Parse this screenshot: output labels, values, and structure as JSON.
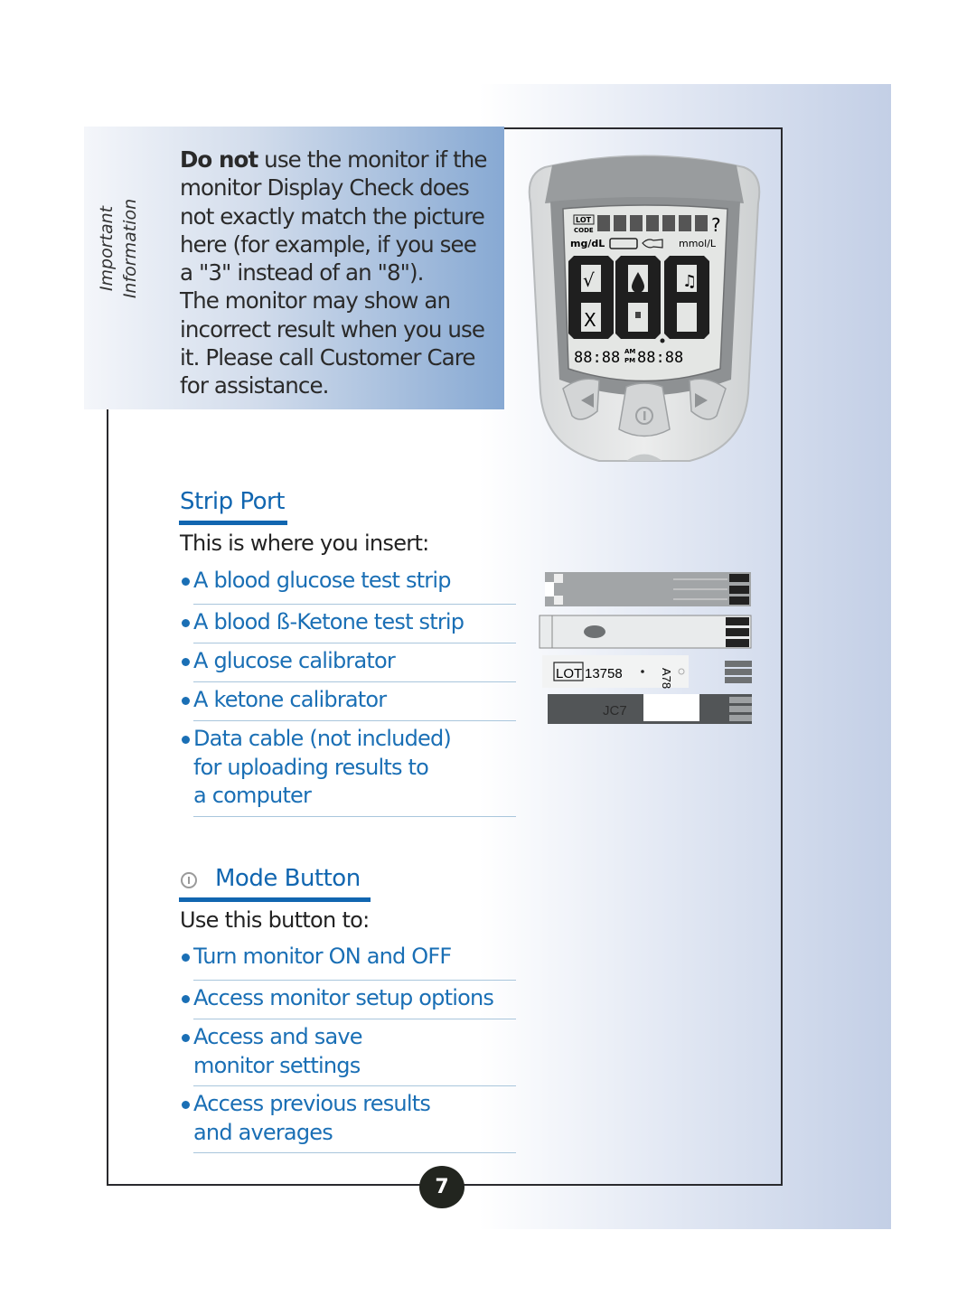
{
  "info_box": {
    "side_label_line1": "Important",
    "side_label_line2": "Information",
    "bold_lead": "Do not",
    "lines": [
      " use the monitor if the",
      "monitor Display Check does",
      "not exactly match the picture",
      "here (for example, if you see",
      "a \"3\" instead of an \"8\").",
      "The monitor may show an",
      "incorrect result when you use",
      "it. Please call Customer Care",
      "for assistance."
    ]
  },
  "meter_display": {
    "lot_label": "LOT",
    "code_label": "CODE",
    "question_mark": "?",
    "unit_left": "mg/dL",
    "unit_right": "mmol/L",
    "time_left": "88:88",
    "am": "AM",
    "pm": "PM",
    "time_right": "88:88",
    "icons": [
      "check-icon",
      "x-icon",
      "blood-drop-icon",
      "strip-icon",
      "music-note-icon",
      "battery-icon",
      "strip-insert-icon"
    ],
    "buttons": [
      "left-arrow-button",
      "mode-button",
      "right-arrow-button"
    ]
  },
  "strip_port": {
    "title": "Strip Port",
    "intro": "This is where you insert:",
    "items": [
      {
        "lines": [
          "A blood glucose test strip"
        ]
      },
      {
        "lines": [
          "A blood ß-Ketone test strip"
        ]
      },
      {
        "lines": [
          "A glucose calibrator"
        ]
      },
      {
        "lines": [
          "A ketone calibrator"
        ]
      },
      {
        "lines": [
          "Data cable (not included)",
          "for uploading results to",
          "a computer"
        ]
      }
    ]
  },
  "strips_image": {
    "lot_label": "LOT",
    "lot_number": "13758",
    "lot_code": "A78",
    "calibrator_code": "JC7"
  },
  "mode_button": {
    "title": "Mode Button",
    "intro": "Use this button to:",
    "items": [
      {
        "lines": [
          "Turn monitor ON and OFF"
        ]
      },
      {
        "lines": [
          "Access monitor setup options"
        ]
      },
      {
        "lines": [
          "Access and save",
          "monitor settings"
        ]
      },
      {
        "lines": [
          "Access previous results",
          "and averages"
        ]
      }
    ]
  },
  "page_number": "7"
}
